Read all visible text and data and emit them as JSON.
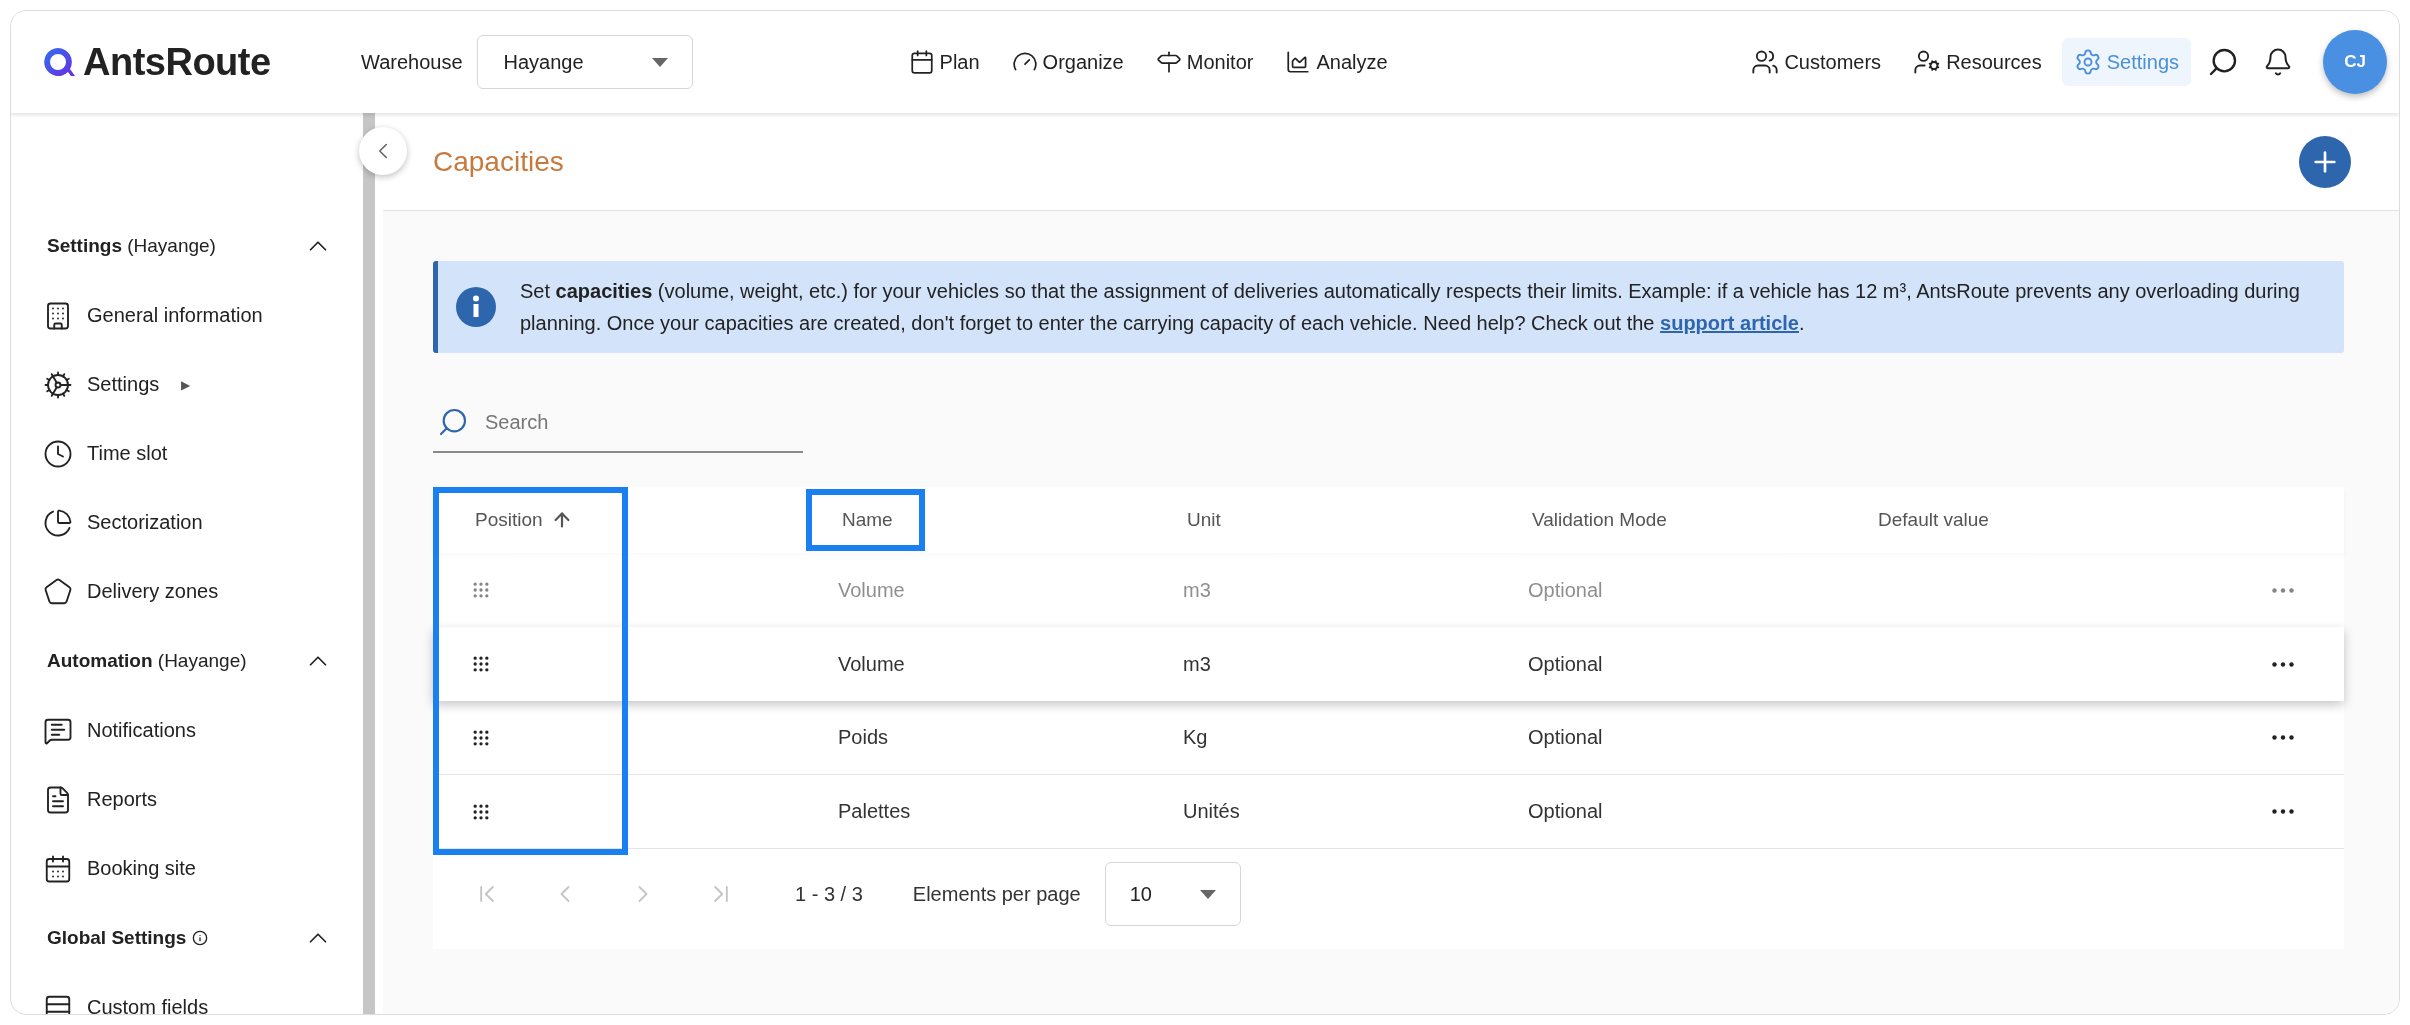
{
  "header": {
    "logo": "AntsRoute",
    "warehouse_label": "Warehouse",
    "warehouse_value": "Hayange",
    "nav_main": [
      {
        "label": "Plan",
        "selected": false
      },
      {
        "label": "Organize",
        "selected": false
      },
      {
        "label": "Monitor",
        "selected": false
      },
      {
        "label": "Analyze",
        "selected": false
      }
    ],
    "nav_right": [
      {
        "label": "Customers",
        "selected": false
      },
      {
        "label": "Resources",
        "selected": false
      },
      {
        "label": "Settings",
        "selected": true
      }
    ],
    "avatar": "CJ"
  },
  "sidebar": {
    "sections": [
      {
        "title": "Settings",
        "suffix": "(Hayange)",
        "expanded": true,
        "items": [
          {
            "label": "General information"
          },
          {
            "label": "Settings",
            "marker": "▶"
          },
          {
            "label": "Time slot"
          },
          {
            "label": "Sectorization"
          },
          {
            "label": "Delivery zones"
          }
        ]
      },
      {
        "title": "Automation",
        "suffix": "(Hayange)",
        "expanded": true,
        "items": [
          {
            "label": "Notifications"
          },
          {
            "label": "Reports"
          },
          {
            "label": "Booking site"
          }
        ]
      },
      {
        "title": "Global Settings",
        "info": true,
        "expanded": true,
        "items": [
          {
            "label": "Custom fields"
          }
        ]
      }
    ]
  },
  "page": {
    "title": "Capacities",
    "info_text": "Set **capacities** (volume, weight, etc.) for your vehicles so that the assignment of deliveries automatically respects their limits. Example: if a vehicle has 12 m³, AntsRoute prevents any overloading during planning. Once your capacities are created, don't forget to enter the carrying capacity of each vehicle. Need help? Check out the",
    "info_link": "support article",
    "info_end": ".",
    "search": {
      "placeholder": "Search"
    },
    "table": {
      "columns": [
        {
          "label": "Position",
          "sorted": true,
          "framed_header": false,
          "framed_column": true
        },
        {
          "label": "Name",
          "sorted": false,
          "framed_header": true,
          "framed_column": false
        },
        {
          "label": "Unit",
          "sorted": false,
          "framed_header": false,
          "framed_column": false
        },
        {
          "label": "Validation Mode",
          "sorted": false,
          "framed_header": false,
          "framed_column": false
        },
        {
          "label": "Default value",
          "sorted": false,
          "framed_header": false,
          "framed_column": false
        }
      ],
      "rows": [
        {
          "kind": "placeholder",
          "name": "Volume",
          "unit": "m3",
          "validation_mode": "Optional"
        },
        {
          "kind": "dragged",
          "name": "Volume",
          "unit": "m3",
          "validation_mode": "Optional"
        },
        {
          "kind": "normal",
          "name": "Poids",
          "unit": "Kg",
          "validation_mode": "Optional"
        },
        {
          "kind": "normal",
          "name": "Palettes",
          "unit": "Unités",
          "validation_mode": "Optional"
        }
      ]
    },
    "pagination": {
      "range": "1 - 3 / 3",
      "per_page_label": "Elements per page",
      "per_page": "10",
      "buttons": [
        {
          "disabled": true
        },
        {
          "disabled": true
        },
        {
          "disabled": true
        },
        {
          "disabled": true
        }
      ]
    }
  }
}
